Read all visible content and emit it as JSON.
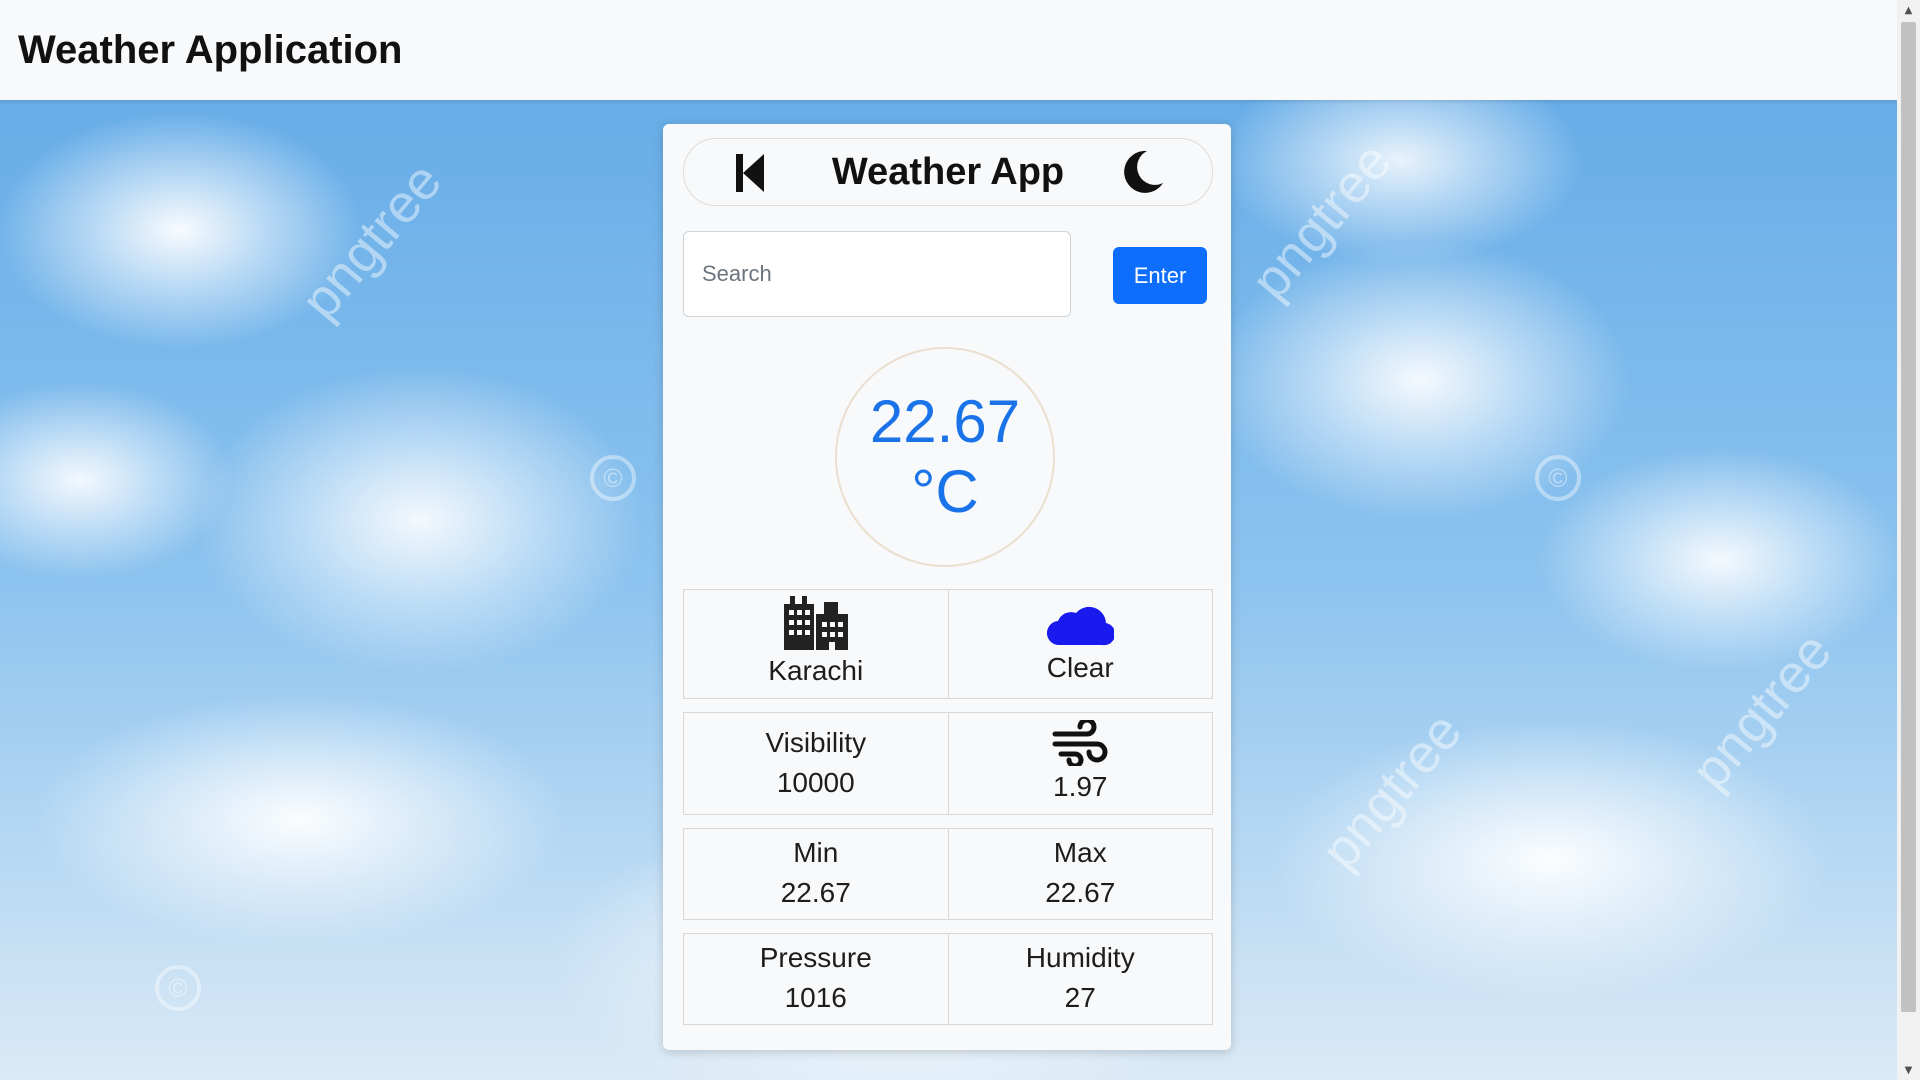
{
  "navbar": {
    "title": "Weather Application"
  },
  "background": {
    "watermark_text": "pngtree",
    "watermark_symbol": "©"
  },
  "app": {
    "title": "Weather App",
    "back_icon": "skip-back-icon",
    "theme_icon": "moon-icon"
  },
  "search": {
    "placeholder": "Search",
    "value": "",
    "button_label": "Enter",
    "button_color": "#0d6efd"
  },
  "temperature": {
    "value": "22.67",
    "unit": "°C",
    "color": "#1a73e8"
  },
  "details": {
    "city": {
      "icon": "city-buildings-icon",
      "value": "Karachi"
    },
    "condition": {
      "icon": "cloud-icon",
      "value": "Clear",
      "icon_color": "#1a1aef"
    },
    "visibility": {
      "label": "Visibility",
      "value": "10000"
    },
    "wind": {
      "icon": "wind-icon",
      "value": "1.97"
    },
    "min": {
      "label": "Min",
      "value": "22.67"
    },
    "max": {
      "label": "Max",
      "value": "22.67"
    },
    "pressure": {
      "label": "Pressure",
      "value": "1016"
    },
    "humidity": {
      "label": "Humidity",
      "value": "27"
    }
  }
}
